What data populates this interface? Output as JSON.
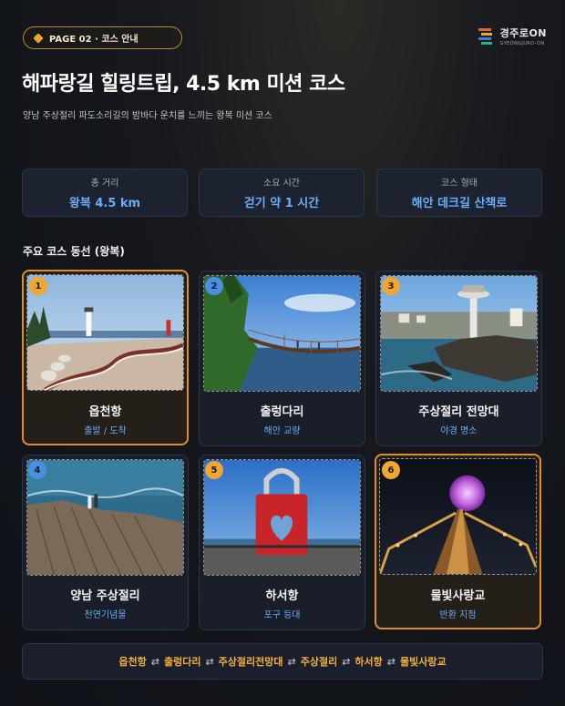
{
  "header": {
    "page_badge": "PAGE 02 · 코스 안내",
    "logo_main": "경주로ON",
    "logo_sub": "GYEONGJURO-ON"
  },
  "title": "해파랑길 힐링트립, 4.5 km 미션 코스",
  "subtitle": "양남 주상절리 파도소리길의 밤바다 운치를 느끼는 왕복 미션 코스",
  "stats": [
    {
      "label": "총 거리",
      "value": "왕복 4.5 km"
    },
    {
      "label": "소요 시간",
      "value": "걷기 약 1 시간"
    },
    {
      "label": "코스 형태",
      "value": "해안 데크길 산책로"
    }
  ],
  "section_title": "주요 코스 동선 (왕복)",
  "stops": [
    {
      "number": "1",
      "name": "읍천항",
      "desc": "출발 / 도착",
      "image": "harbor-lighthouse-photo"
    },
    {
      "number": "2",
      "name": "출렁다리",
      "desc": "해안 교량",
      "image": "suspension-bridge-photo"
    },
    {
      "number": "3",
      "name": "주상절리 전망대",
      "desc": "야경 명소",
      "image": "observatory-tower-photo"
    },
    {
      "number": "4",
      "name": "양남 주상절리",
      "desc": "천연기념물",
      "image": "columnar-joint-rocks-photo"
    },
    {
      "number": "5",
      "name": "하서항",
      "desc": "포구 등대",
      "image": "heart-lock-sculpture-photo"
    },
    {
      "number": "6",
      "name": "물빛사랑교",
      "desc": "반환 지점",
      "image": "night-bridge-photo"
    }
  ],
  "route": {
    "items": [
      "읍천항",
      "출렁다리",
      "주상절리전망대",
      "주상절리",
      "하서항",
      "물빛사랑교"
    ],
    "separator": "⇄"
  },
  "colors": {
    "accent_orange": "#e08d2d",
    "number_orange": "#f0a630",
    "number_blue": "#4a90e2",
    "value_blue": "#6aaef7",
    "route_gold": "#f2b13c"
  }
}
